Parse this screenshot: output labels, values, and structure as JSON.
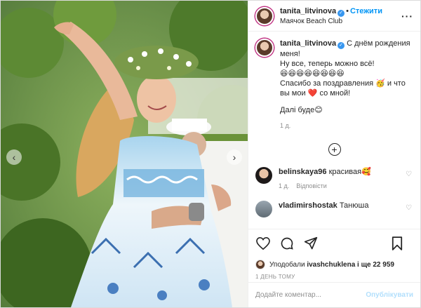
{
  "colors": {
    "accent": "#0095f6",
    "heart": "#ed4956",
    "muted": "#8e8e8e",
    "border": "#dbdbdb"
  },
  "post": {
    "author": "tanita_litvinova",
    "follow_label": "Стежити",
    "location": "Маячок Beach Club",
    "caption_lines": [
      "С днём рождения меня!",
      "Ну все, теперь можно всё!",
      "😆😆😆😆😆😆😆😆",
      "Спасибо за поздравления 🥳 и что вы мои ❤️ со мной!",
      "",
      "Далі буде😊"
    ],
    "caption_time": "1 д."
  },
  "comments": [
    {
      "user": "belinskaya96",
      "text": "красивая🥰",
      "time": "1 д.",
      "reply_label": "Відповісти"
    },
    {
      "user": "vladimirshostak",
      "text": "Танюша",
      "time": "",
      "reply_label": ""
    }
  ],
  "likes": {
    "prefix": "Уподобали",
    "user": "ivashchuklena",
    "suffix": "і ще 22 959"
  },
  "date_label": "1 ДЕНЬ ТОМУ",
  "add_comment": {
    "placeholder": "Додайте коментар...",
    "publish_label": "Опублікувати"
  },
  "icons": {
    "verified": "verified-icon",
    "more": "more-icon",
    "like": "heart-icon",
    "comment": "comment-icon",
    "share": "share-icon",
    "save": "bookmark-icon",
    "load_more": "plus-circle-icon",
    "prev": "chevron-left-icon",
    "next": "chevron-right-icon"
  }
}
